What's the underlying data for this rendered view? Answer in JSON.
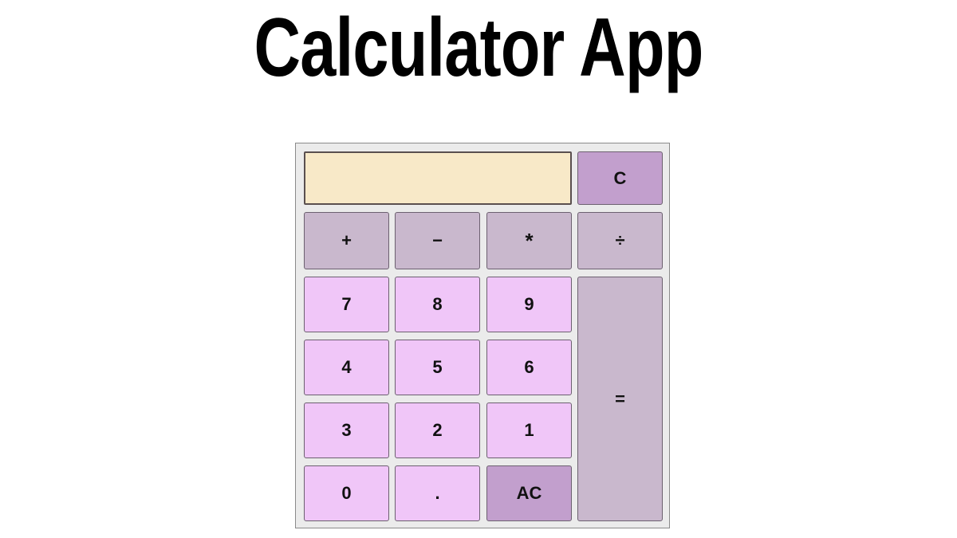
{
  "app": {
    "title": "Calculator App"
  },
  "display": {
    "value": ""
  },
  "buttons": {
    "clear": "C",
    "plus": "+",
    "minus": "−",
    "multiply": "*",
    "divide": "÷",
    "seven": "7",
    "eight": "8",
    "nine": "9",
    "four": "4",
    "five": "5",
    "six": "6",
    "three": "3",
    "two": "2",
    "one": "1",
    "zero": "0",
    "decimal": ".",
    "all_clear": "AC",
    "equals": "="
  },
  "colors": {
    "display_bg": "#f8e9c8",
    "number_button": "#f0c6f8",
    "operator_button": "#c9b8cd",
    "action_button": "#c29fcd",
    "panel_bg": "#ebebeb"
  }
}
